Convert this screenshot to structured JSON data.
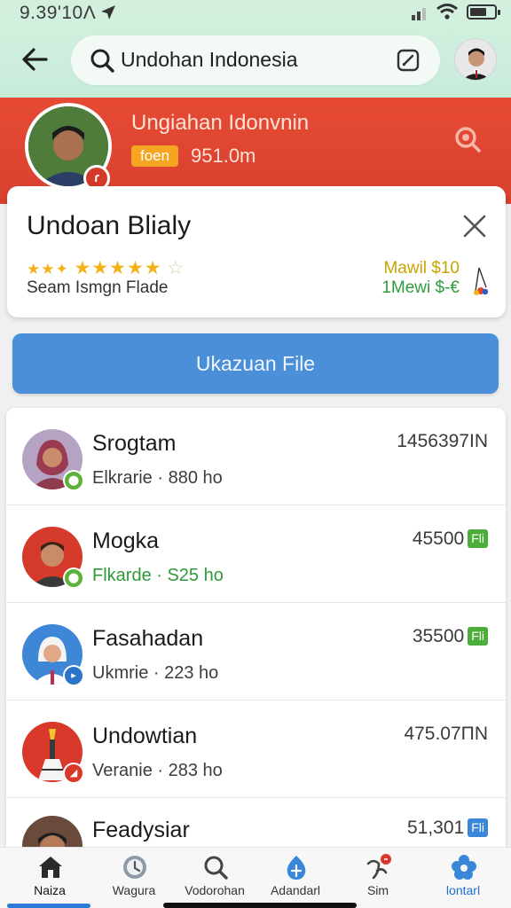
{
  "status_bar": {
    "time": "9.39'10Λ"
  },
  "header": {
    "search_text": "Undohan Indonesia"
  },
  "banner": {
    "title": "Ungiahan Idonvnin",
    "chip": "foen",
    "value": "951.0m",
    "badge": "ɾ"
  },
  "card": {
    "title": "Undoan Blialy",
    "stars_small": "★★✦",
    "stars_full": "★★★★★",
    "star_empty": "☆",
    "subtitle": "Seam Ismgn Flade",
    "price_primary": "Mawil $10",
    "price_secondary": "1Mewi $-€"
  },
  "primary_button": {
    "label": "Ukazuan File"
  },
  "list": {
    "rows": [
      {
        "name": "Srogtam",
        "meta": "Elkrarie · 880 ho",
        "amount": "1456397IN",
        "tag": "",
        "tag_color": "",
        "avatar_bg": "#a64a5a",
        "mini_color": "#5bb139"
      },
      {
        "name": "Mogka",
        "meta": "Flkarde · S25 ho",
        "amount": "45500",
        "tag": "Fli",
        "tag_color": "#4cae3a",
        "avatar_bg": "#d63a2a",
        "mini_color": "#5bb139"
      },
      {
        "name": "Fasahadan",
        "meta": "Ukmrie · 223 ho",
        "amount": "35500",
        "tag": "Fli",
        "tag_color": "#4cae3a",
        "avatar_bg": "#3e86d6",
        "mini_color": "#2c74c9"
      },
      {
        "name": "Undowtian",
        "meta": "Veranie · 283 ho",
        "amount": "475.07ΠN",
        "tag": "",
        "tag_color": "",
        "avatar_bg": "#d8392a",
        "mini_color": "#d8392a"
      },
      {
        "name": "Feadysiar",
        "meta": "",
        "amount": "51,301",
        "tag": "Fli",
        "tag_color": "#3a86d8",
        "avatar_bg": "#6a4a3a",
        "mini_color": "#2c74c9"
      }
    ]
  },
  "bottom_nav": [
    {
      "label": "Naiza",
      "icon": "home-icon"
    },
    {
      "label": "Wagura",
      "icon": "clock-icon"
    },
    {
      "label": "Vodorohan",
      "icon": "search-icon"
    },
    {
      "label": "Adandarl",
      "icon": "flame-icon"
    },
    {
      "label": "Sim",
      "icon": "pin-icon"
    },
    {
      "label": "lontarl",
      "icon": "flower-icon"
    }
  ],
  "colors": {
    "banner_red": "#e64a34",
    "primary_blue": "#4a8fd8",
    "chip_orange": "#f6a523",
    "accent_green": "#2e9a3a"
  }
}
